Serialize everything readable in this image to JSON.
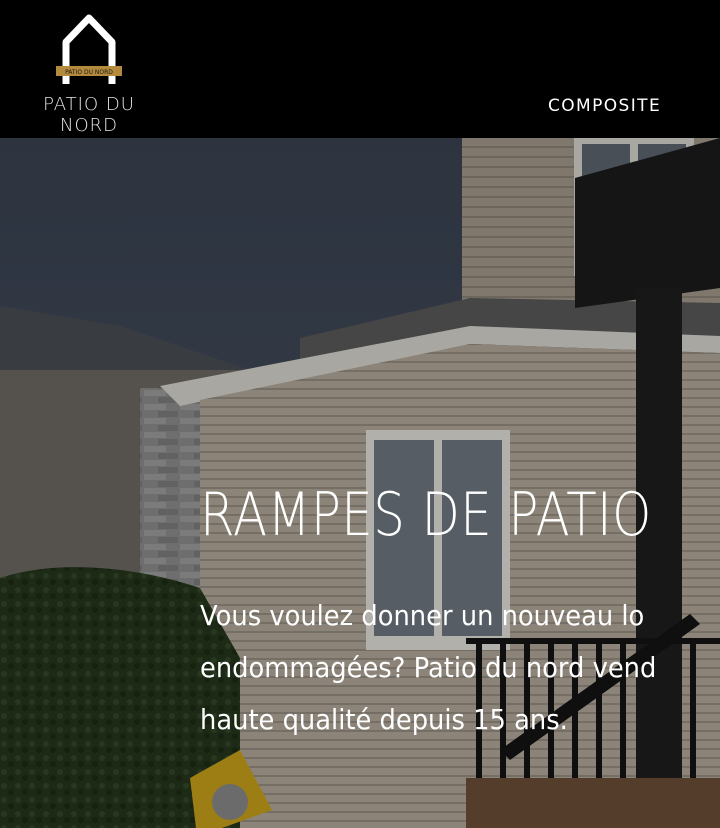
{
  "header": {
    "brand": "PATIO DU NORD",
    "logo_tagline": "PATIO DU NORD",
    "nav": [
      {
        "label": "COMPOSITE"
      }
    ]
  },
  "hero": {
    "title": "RAMPES DE PATIO",
    "text": "Vous voulez donner un nouveau lo\nendommagées? Patio du nord vend\nhaute qualité depuis 15 ans."
  },
  "colors": {
    "header_bg": "#000000",
    "logo_gold": "#b48a3c",
    "text": "#ffffff"
  }
}
